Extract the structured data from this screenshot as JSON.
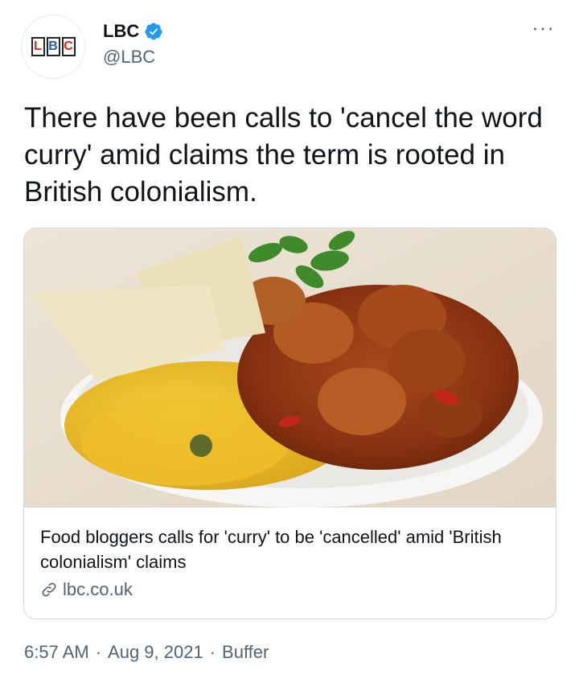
{
  "author": {
    "name": "LBC",
    "handle": "@LBC",
    "avatar_letters": [
      "L",
      "B",
      "C"
    ],
    "verified": true
  },
  "more_label": "···",
  "tweet": {
    "text": "There have been calls to 'cancel the word curry' amid claims the term is rooted in British colonialism."
  },
  "card": {
    "title": "Food bloggers calls for 'curry' to be 'cancelled' amid 'British colonialism' claims",
    "domain": "lbc.co.uk",
    "icon": "link-icon"
  },
  "meta": {
    "time": "6:57 AM",
    "sep1": "·",
    "date": "Aug 9, 2021",
    "sep2": "·",
    "source": "Buffer"
  },
  "colors": {
    "verified": "#1d9bf0",
    "secondary_text": "#536471",
    "logo_red": "#e2231a",
    "logo_blue": "#1f5fb0"
  }
}
